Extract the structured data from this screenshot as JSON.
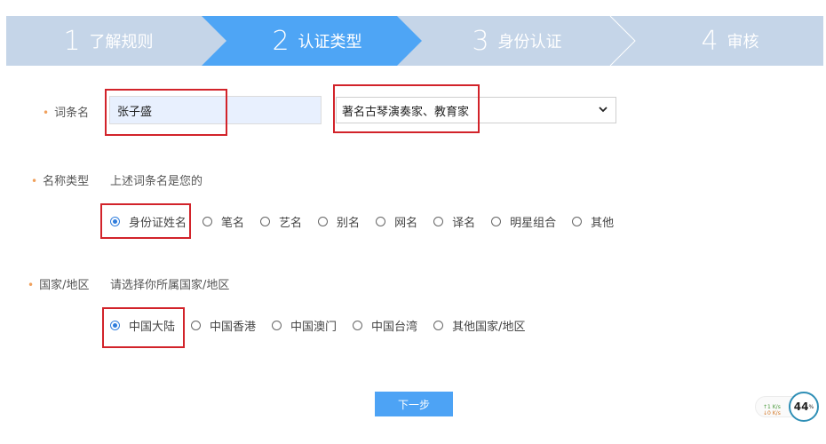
{
  "stepper": {
    "steps": [
      {
        "num": "1",
        "label": "了解规则",
        "state": "done"
      },
      {
        "num": "2",
        "label": "认证类型",
        "state": "active"
      },
      {
        "num": "3",
        "label": "身份认证",
        "state": "pending"
      },
      {
        "num": "4",
        "label": "审核",
        "state": "pending"
      }
    ],
    "colors": {
      "inactive_bg": "#c5d5e8",
      "active_bg": "#4ea5f5",
      "text": "#ffffff"
    }
  },
  "entry_name": {
    "required_mark": "•",
    "label": "词条名",
    "value": "张子盛",
    "description_value": "著名古琴演奏家、教育家",
    "dropdown_icon": "chevron-down-icon"
  },
  "name_type": {
    "required_mark": "•",
    "label": "名称类型",
    "hint": "上述词条名是您的",
    "options": [
      {
        "label": "身份证姓名",
        "checked": true
      },
      {
        "label": "笔名",
        "checked": false
      },
      {
        "label": "艺名",
        "checked": false
      },
      {
        "label": "别名",
        "checked": false
      },
      {
        "label": "网名",
        "checked": false
      },
      {
        "label": "译名",
        "checked": false
      },
      {
        "label": "明星组合",
        "checked": false
      },
      {
        "label": "其他",
        "checked": false
      }
    ]
  },
  "region": {
    "required_mark": "•",
    "label": "国家/地区",
    "hint": "请选择你所属国家/地区",
    "options": [
      {
        "label": "中国大陆",
        "checked": true
      },
      {
        "label": "中国香港",
        "checked": false
      },
      {
        "label": "中国澳门",
        "checked": false
      },
      {
        "label": "中国台湾",
        "checked": false
      },
      {
        "label": "其他国家/地区",
        "checked": false
      }
    ]
  },
  "next_button": {
    "label": "下一步",
    "color": "#4da3f5"
  },
  "network_widget": {
    "upload": "↑1 K/s",
    "download": "↓0 K/s",
    "percent": "44",
    "percent_unit": "%"
  },
  "annotation_color": "#d2232a"
}
